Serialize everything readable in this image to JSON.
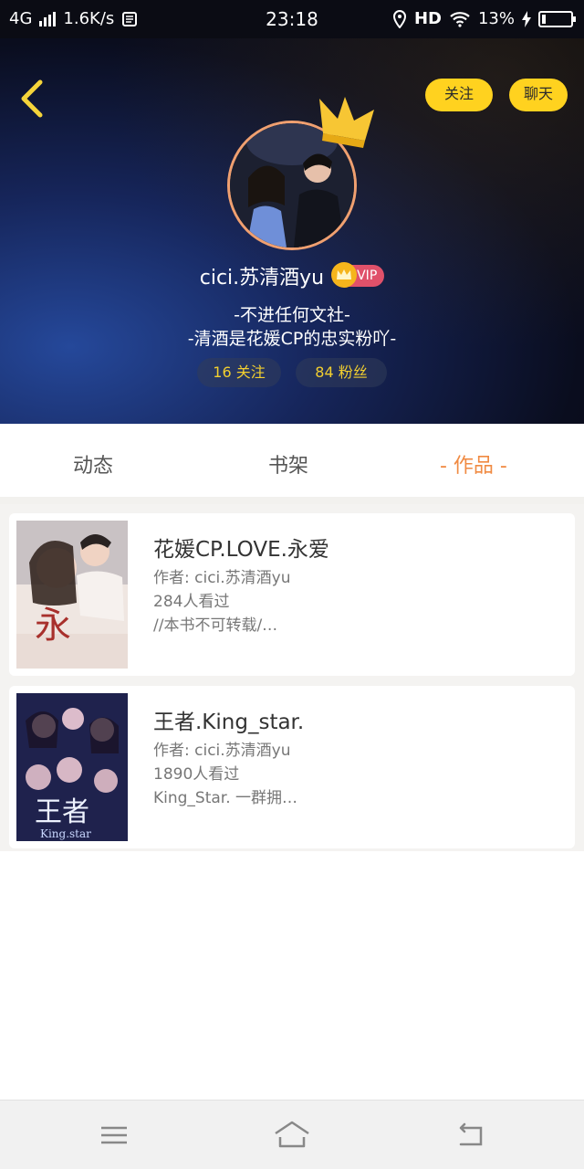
{
  "status_bar": {
    "network": "4G",
    "speed": "1.6K/s",
    "time": "23:18",
    "hd": "HD",
    "battery": "13%",
    "battery_level": 0.13
  },
  "header": {
    "follow_label": "关注",
    "chat_label": "聊天",
    "username": "cici.苏清酒yu",
    "vip_label": "VIP",
    "bio_line1": "-不进任何文社-",
    "bio_line2": "-清酒是花媛CP的忠实粉吖-",
    "follows": "16 关注",
    "fans": "84 粉丝"
  },
  "tabs": [
    "动态",
    "书架",
    "- 作品 -"
  ],
  "active_tab": 2,
  "colors": {
    "accent_yellow": "#ffd21f",
    "active_tab": "#f08a42",
    "stat_text": "#f2cf2f",
    "vip_badge": "#e0516a"
  },
  "books": [
    {
      "title": "花媛CP.LOVE.永爱",
      "author": "作者: cici.苏清酒yu",
      "views": "284人看过",
      "desc": "//本书不可转载/…",
      "cover_text": "永"
    },
    {
      "title": "王者.King_star.",
      "author": "作者: cici.苏清酒yu",
      "views": "1890人看过",
      "desc": "King_Star. 一群拥…",
      "cover_text": "王者",
      "cover_subtext": "King.star"
    }
  ]
}
